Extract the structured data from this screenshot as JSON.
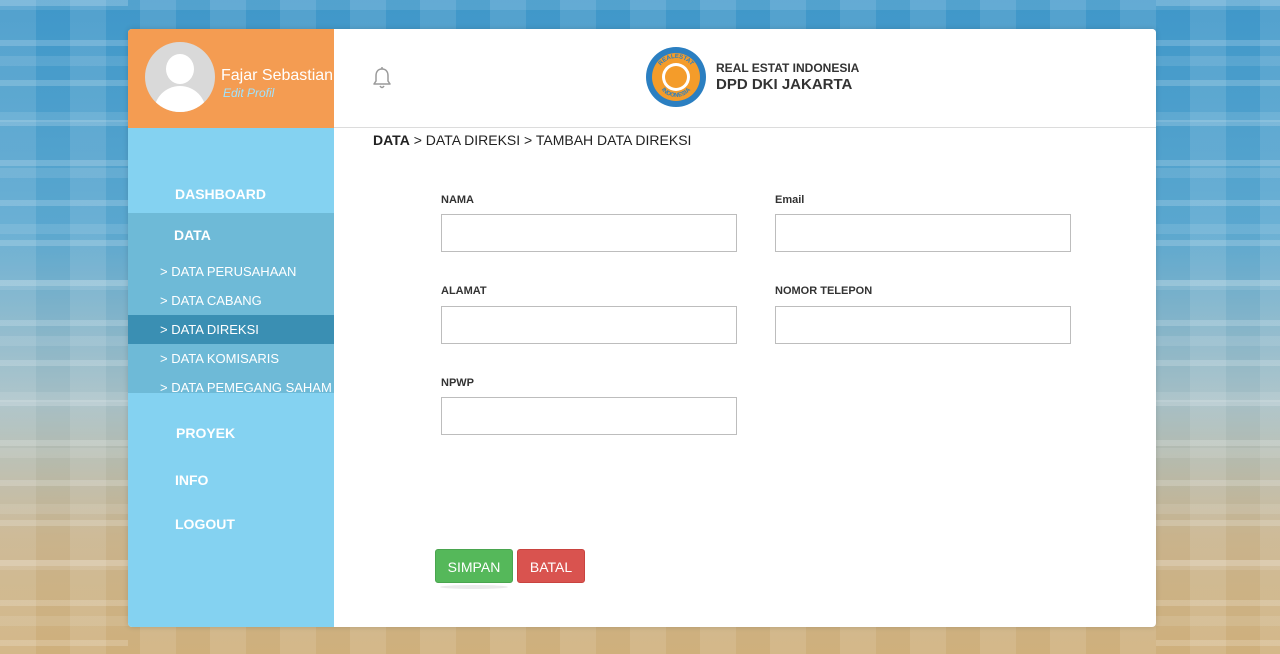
{
  "profile": {
    "name": "Fajar Sebastian",
    "edit_label": "Edit Profil"
  },
  "sidebar": {
    "dashboard": "DASHBOARD",
    "data": "DATA",
    "data_items": [
      "> DATA PERUSAHAAN",
      "> DATA CABANG",
      "> DATA DIREKSI",
      "> DATA KOMISARIS",
      "> DATA PEMEGANG SAHAM"
    ],
    "active_item": "> DATA DIREKSI",
    "proyek": "PROYEK",
    "info": "INFO",
    "logout": "LOGOUT"
  },
  "header": {
    "logo_line1": "REAL ESTAT INDONESIA",
    "logo_line2": "DPD DKI JAKARTA",
    "logo_ring_text_top": "REALESTAT",
    "logo_ring_text_bottom": "INDONESIA",
    "bell_icon": "bell-icon"
  },
  "breadcrumb": {
    "root": "DATA",
    "rest": " > DATA DIREKSI > TAMBAH DATA DIREKSI"
  },
  "form": {
    "nama_label": "NAMA",
    "nama_value": "",
    "email_label": "Email",
    "email_value": "",
    "alamat_label": "ALAMAT",
    "alamat_value": "",
    "telepon_label": "NOMOR TELEPON",
    "telepon_value": "",
    "npwp_label": "NPWP",
    "npwp_value": ""
  },
  "buttons": {
    "save": "SIMPAN",
    "cancel": "BATAL"
  },
  "colors": {
    "profile_bg": "#f49c52",
    "sidebar_bg": "#84d2f1",
    "data_group_bg": "#6ebad7",
    "active_item_bg": "#3a8fb3",
    "save_bg": "#55b85a",
    "cancel_bg": "#d9534f",
    "logo_orange": "#f49c2a",
    "logo_blue": "#2b7fc1"
  }
}
